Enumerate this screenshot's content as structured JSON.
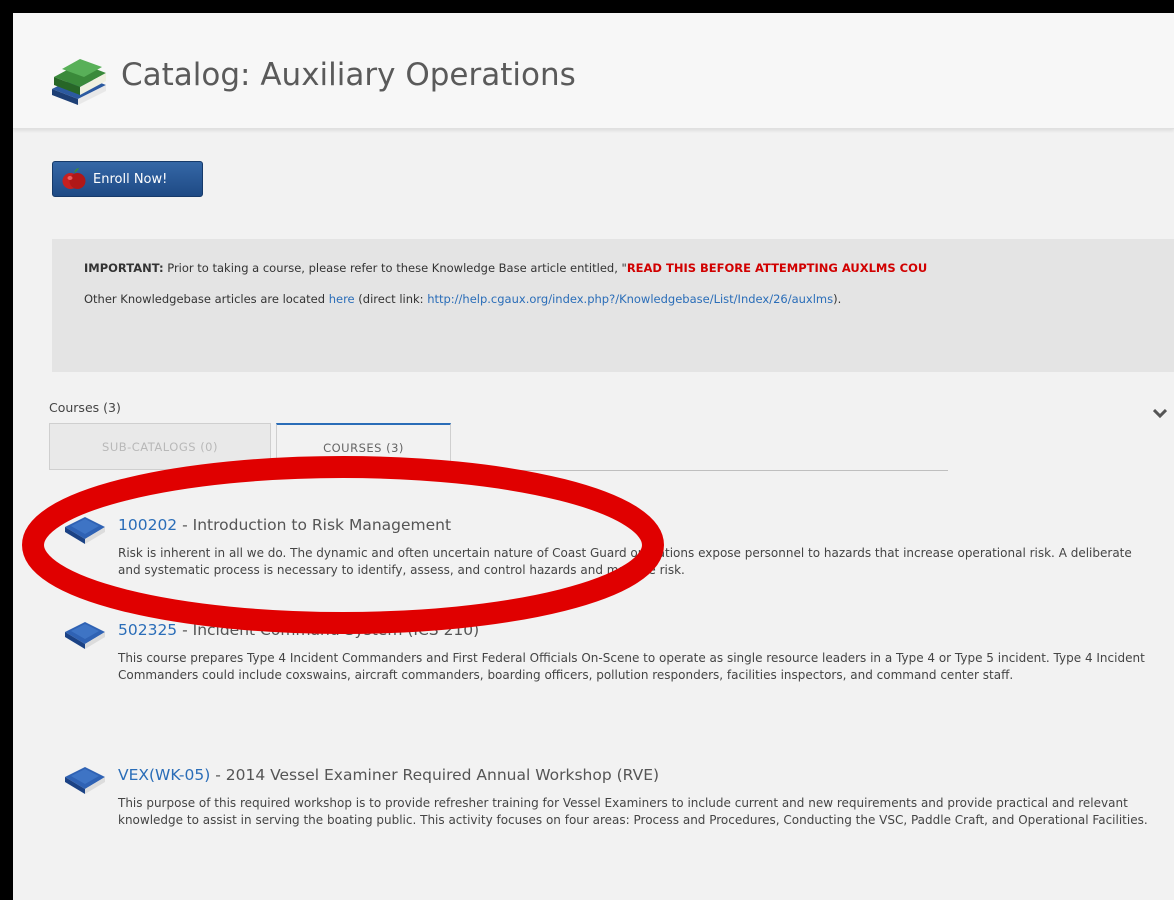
{
  "header": {
    "title": "Catalog: Auxiliary Operations",
    "icon": "catalog-books-icon"
  },
  "enroll": {
    "label": "Enroll Now!",
    "icon": "apple-icon"
  },
  "notice": {
    "line1_prefix": "IMPORTANT:",
    "line1_text": " Prior to taking a course, please refer to these Knowledge Base article entitled, \"",
    "line1_highlight": "READ THIS BEFORE ATTEMPTING AUXLMS COU",
    "line2_text": "Other Knowledgebase articles are located ",
    "line2_link": "here",
    "line2_middle": " (direct link: ",
    "line2_url": "http://help.cgaux.org/index.php?/Knowledgebase/List/Index/26/auxlms",
    "line2_end": ")."
  },
  "courses_section": {
    "count_label": "Courses (3)",
    "tabs": [
      {
        "label": "SUB-CATALOGS (0)"
      },
      {
        "label": "COURSES (3)"
      }
    ]
  },
  "courses": [
    {
      "code": "100202",
      "name": " - Introduction to Risk Management",
      "description": "Risk is inherent in all we do. The dynamic and often uncertain nature of Coast Guard operations expose personnel to hazards that increase operational risk. A deliberate and systematic process is necessary to identify, assess, and control hazards and manage risk."
    },
    {
      "code": "502325",
      "name": " - Incident Command System (ICS 210)",
      "description": "This course prepares Type 4 Incident Commanders and First Federal Officials On-Scene to operate as single resource leaders in a Type 4 or Type 5 incident. Type 4 Incident Commanders could include coxswains, aircraft commanders, boarding officers, pollution responders, facilities inspectors, and command center staff."
    },
    {
      "code": "VEX(WK-05)",
      "name": " - 2014 Vessel Examiner Required Annual Workshop (RVE)",
      "description": "This purpose of this required workshop is to provide refresher training for Vessel Examiners to include current and new requirements and provide practical and relevant knowledge to assist in serving the boating public. This activity focuses on four areas: Process and Procedures, Conducting the VSC, Paddle Craft, and Operational Facilities."
    }
  ],
  "colors": {
    "link": "#2a6db8",
    "highlight": "#d10000",
    "annotation": "#e00000",
    "button": "#1e4a85"
  }
}
